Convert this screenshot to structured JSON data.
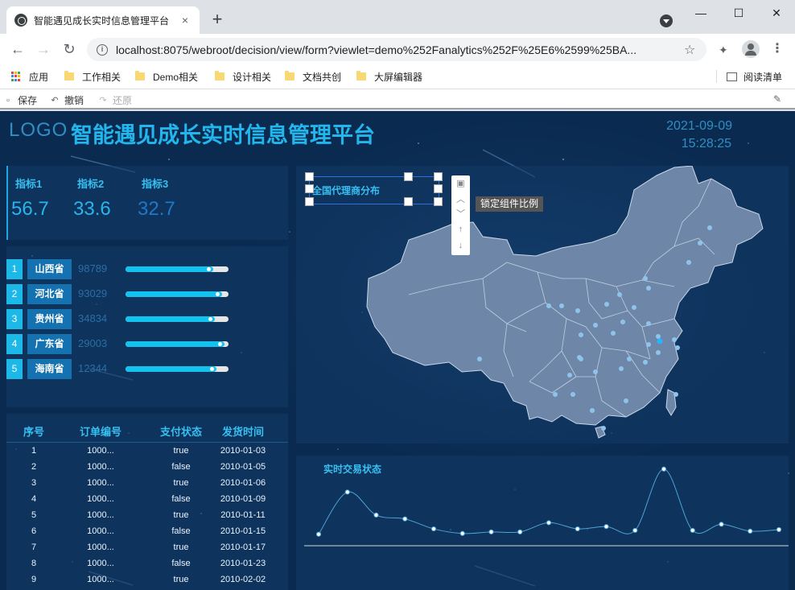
{
  "browser": {
    "tab_title": "智能遇见成长实时信息管理平台",
    "tab_close": "×",
    "new_tab": "+",
    "url": "localhost:8075/webroot/decision/view/form?viewlet=demo%252Fanalytics%252F%25E6%2599%25BA...",
    "window_controls": {
      "minimize": "—",
      "maximize": "☐",
      "close": "✕"
    },
    "bookmarks": [
      {
        "label": "应用"
      },
      {
        "label": "工作相关"
      },
      {
        "label": "Demo相关"
      },
      {
        "label": "设计相关"
      },
      {
        "label": "文档共创"
      },
      {
        "label": "大屏编辑器"
      }
    ],
    "reading_list": "阅读清单"
  },
  "designer": {
    "save": "保存",
    "undo": "撤销",
    "redo": "还原"
  },
  "header": {
    "logo": "LOGO",
    "title": "智能遇见成长实时信息管理平台",
    "date": "2021-09-09",
    "time": "15:28:25"
  },
  "kpis": [
    {
      "label": "指标1",
      "value": "56.7",
      "color": "#2ab4ec"
    },
    {
      "label": "指标2",
      "value": "33.6",
      "color": "#2ab4ec"
    },
    {
      "label": "指标3",
      "value": "32.7",
      "color": "#1f78c8"
    }
  ],
  "ranking": [
    {
      "rank": "1",
      "province": "山西省",
      "value": "98789",
      "fill": 0.85
    },
    {
      "rank": "2",
      "province": "河北省",
      "value": "93029",
      "fill": 0.94
    },
    {
      "rank": "3",
      "province": "贵州省",
      "value": "34834",
      "fill": 0.87
    },
    {
      "rank": "4",
      "province": "广东省",
      "value": "29003",
      "fill": 0.96
    },
    {
      "rank": "5",
      "province": "海南省",
      "value": "12344",
      "fill": 0.88
    }
  ],
  "table": {
    "headers": [
      "序号",
      "订单编号",
      "支付状态",
      "发货时间"
    ],
    "rows": [
      [
        "1",
        "1000...",
        "true",
        "2010-01-03"
      ],
      [
        "2",
        "1000...",
        "false",
        "2010-01-05"
      ],
      [
        "3",
        "1000...",
        "true",
        "2010-01-06"
      ],
      [
        "4",
        "1000...",
        "false",
        "2010-01-09"
      ],
      [
        "5",
        "1000...",
        "true",
        "2010-01-11"
      ],
      [
        "6",
        "1000...",
        "false",
        "2010-01-15"
      ],
      [
        "7",
        "1000...",
        "true",
        "2010-01-17"
      ],
      [
        "8",
        "1000...",
        "false",
        "2010-01-23"
      ],
      [
        "9",
        "1000...",
        "true",
        "2010-02-02"
      ]
    ]
  },
  "map": {
    "title": "全国代理商分布",
    "tooltip": "锁定组件比例"
  },
  "chart_data": {
    "type": "line",
    "title": "实时交易状态",
    "values": [
      15,
      70,
      40,
      35,
      22,
      16,
      18,
      18,
      30,
      22,
      25,
      20,
      100,
      20,
      28,
      19,
      21
    ],
    "ylim": [
      0,
      105
    ]
  }
}
